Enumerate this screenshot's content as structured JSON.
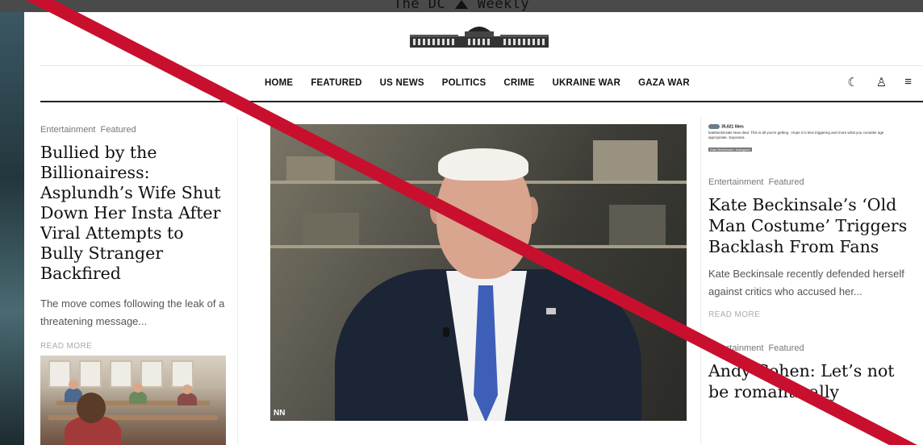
{
  "site": {
    "name_left": "The DC",
    "name_right": "Weekly"
  },
  "nav": {
    "items": [
      "HOME",
      "FEATURED",
      "US NEWS",
      "POLITICS",
      "CRIME",
      "UKRAINE WAR",
      "GAZA WAR"
    ],
    "icons": [
      "moon-icon",
      "user-icon",
      "menu-icon"
    ]
  },
  "left_article": {
    "cats": "Entertainment  Featured",
    "title": "Bullied by the Billionairess: Asplundh’s Wife Shut Down Her Insta After Viral Attempts to Bully Stranger Backfired",
    "excerpt": "The move comes following the leak of a threatening message...",
    "read_more": "READ MORE"
  },
  "hero": {
    "watermark": "NN"
  },
  "right_top": {
    "likes": "35,621 likes",
    "caption": "katebeckinsale New deal. This is all you're getting . Hope it is less triggering and more what you consider age appropriate. Sayonara",
    "chip": "Kate Beckinsale / Instagram"
  },
  "right_article": {
    "cats": "Entertainment  Featured",
    "title": "Kate Beckinsale’s ‘Old Man Costume’ Triggers Backlash From Fans",
    "excerpt": "Kate Beckinsale recently defended herself against critics who accused her...",
    "read_more": "READ MORE"
  },
  "right_article2": {
    "cats": "Entertainment  Featured",
    "title": "Andy Cohen: Let’s not be romantically"
  },
  "colors": {
    "overlay": "#c8102e",
    "nav_border": "#222222"
  }
}
